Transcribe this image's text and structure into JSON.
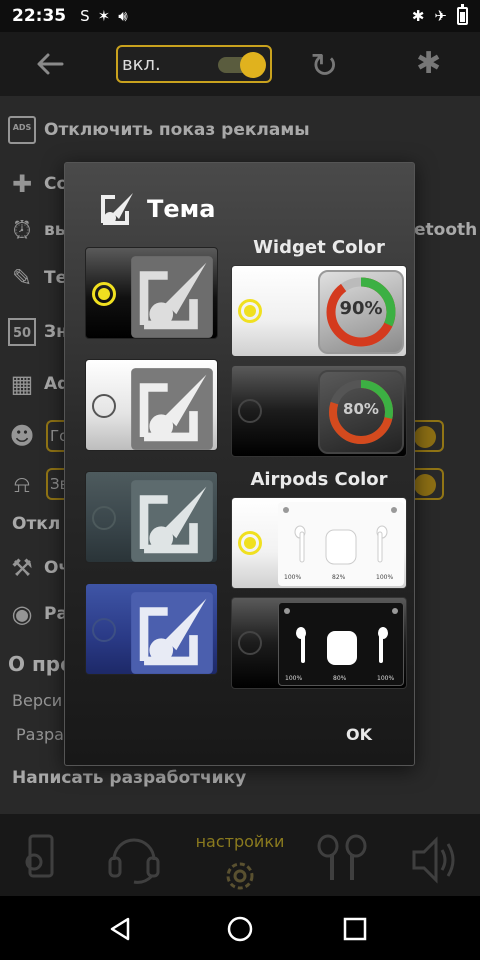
{
  "status_bar": {
    "time": "22:35",
    "left_icons": [
      "sync-s-icon",
      "bluetooth-share-icon",
      "volume-icon"
    ],
    "right_icons": [
      "bluetooth-icon",
      "airplane-icon",
      "battery-icon"
    ]
  },
  "header": {
    "toggle_label": "вкл.",
    "toggle_on": true,
    "accent_color": "#e0b21e"
  },
  "settings_bg": {
    "rows": [
      {
        "icon": "ads-icon",
        "text": "Отключить показ рекламы"
      },
      {
        "icon": "add-device-icon",
        "text": "Со"
      },
      {
        "icon": "alarm-icon",
        "text": "вы",
        "right_text": "etooth"
      },
      {
        "icon": "theme-icon",
        "text": "Те"
      },
      {
        "icon": "calendar-50-icon",
        "text": "Зн"
      },
      {
        "icon": "widgets-icon",
        "text": "Ad"
      },
      {
        "icon": "voice-icon",
        "text": "",
        "box_text": "Го"
      },
      {
        "icon": "bell-icon",
        "text": "",
        "box_text": "Зв"
      },
      {
        "icon": "",
        "text": "Откл"
      },
      {
        "icon": "wrench-icon",
        "text": "Оч"
      },
      {
        "icon": "location-icon",
        "text": "Ра"
      },
      {
        "icon": "",
        "text": "О про"
      },
      {
        "icon": "",
        "text": "Верси"
      },
      {
        "icon": "",
        "text": "Разра"
      },
      {
        "icon": "",
        "text": "Написать разработчику"
      }
    ]
  },
  "bottom_nav": {
    "active_label": "настройки",
    "items": [
      "phone-settings-icon",
      "headset-icon",
      "settings-gear-icon",
      "airpods-icon",
      "speaker-icon"
    ]
  },
  "dialog": {
    "title": "Тема",
    "widget_color_label": "Widget Color",
    "airpods_color_label": "Airpods Color",
    "ok_label": "OK",
    "themes": [
      {
        "name": "dark-theme",
        "selected": true
      },
      {
        "name": "light-theme",
        "selected": false
      },
      {
        "name": "slate-theme",
        "selected": false
      },
      {
        "name": "blue-theme",
        "selected": false
      }
    ],
    "widget_options": [
      {
        "name": "light",
        "percent": "90%",
        "level": 0.9,
        "selected": true
      },
      {
        "name": "dark",
        "percent": "80%",
        "level": 0.8,
        "selected": false
      }
    ],
    "airpods_options": [
      {
        "name": "light",
        "left": "100%",
        "case": "82%",
        "right": "100%",
        "selected": true
      },
      {
        "name": "dark",
        "left": "100%",
        "case": "80%",
        "right": "100%",
        "selected": false
      }
    ]
  }
}
